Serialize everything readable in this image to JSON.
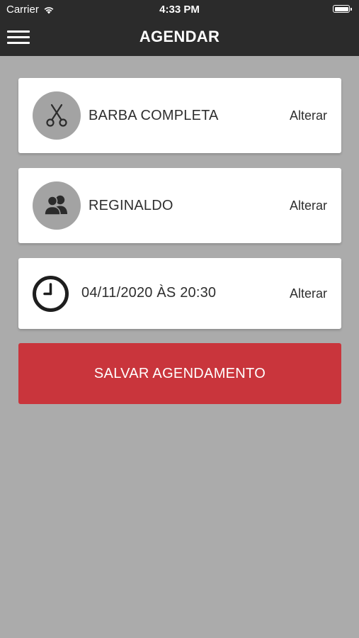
{
  "status_bar": {
    "carrier": "Carrier",
    "time": "4:33 PM"
  },
  "header": {
    "title": "AGENDAR",
    "menu_icon": "hamburger-menu-icon"
  },
  "cards": {
    "service": {
      "icon": "scissors-icon",
      "label": "BARBA COMPLETA",
      "action": "Alterar"
    },
    "barber": {
      "icon": "users-icon",
      "label": "REGINALDO",
      "action": "Alterar"
    },
    "datetime": {
      "icon": "clock-icon",
      "label": "04/11/2020 ÀS 20:30",
      "action": "Alterar"
    }
  },
  "save_button": {
    "label": "SALVAR AGENDAMENTO"
  },
  "colors": {
    "header_bg": "#2b2b2b",
    "page_bg": "#ababab",
    "card_bg": "#ffffff",
    "icon_circle": "#a3a3a3",
    "accent": "#c9353c"
  }
}
